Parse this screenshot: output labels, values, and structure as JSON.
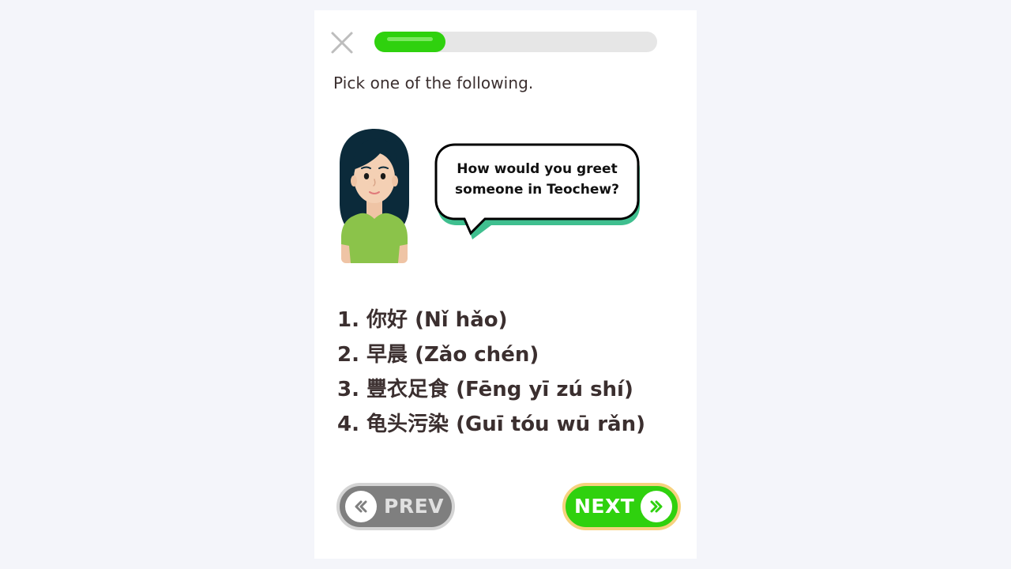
{
  "progress": {
    "value": 0.25
  },
  "header": {
    "close_icon": "close-icon"
  },
  "instruction": "Pick one of the following.",
  "speech_bubble": {
    "line1": "How would you greet",
    "line2": "someone in Teochew?"
  },
  "options": [
    {
      "label": "1. 你好 (Nǐ hǎo)"
    },
    {
      "label": "2. 早晨 (Zǎo chén)"
    },
    {
      "label": "3. 豐衣足食 (Fēng yī zú shí)"
    },
    {
      "label": "4. 龟头污染 (Guī tóu wū rǎn)"
    }
  ],
  "nav": {
    "prev_label": "PREV",
    "next_label": "NEXT"
  },
  "colors": {
    "accent_green": "#2fd10e",
    "prev_gray": "#7f7f7f",
    "next_border": "#f6d27e",
    "bubble_shadow": "#3fbf8f",
    "shirt_green": "#8bc34a"
  }
}
